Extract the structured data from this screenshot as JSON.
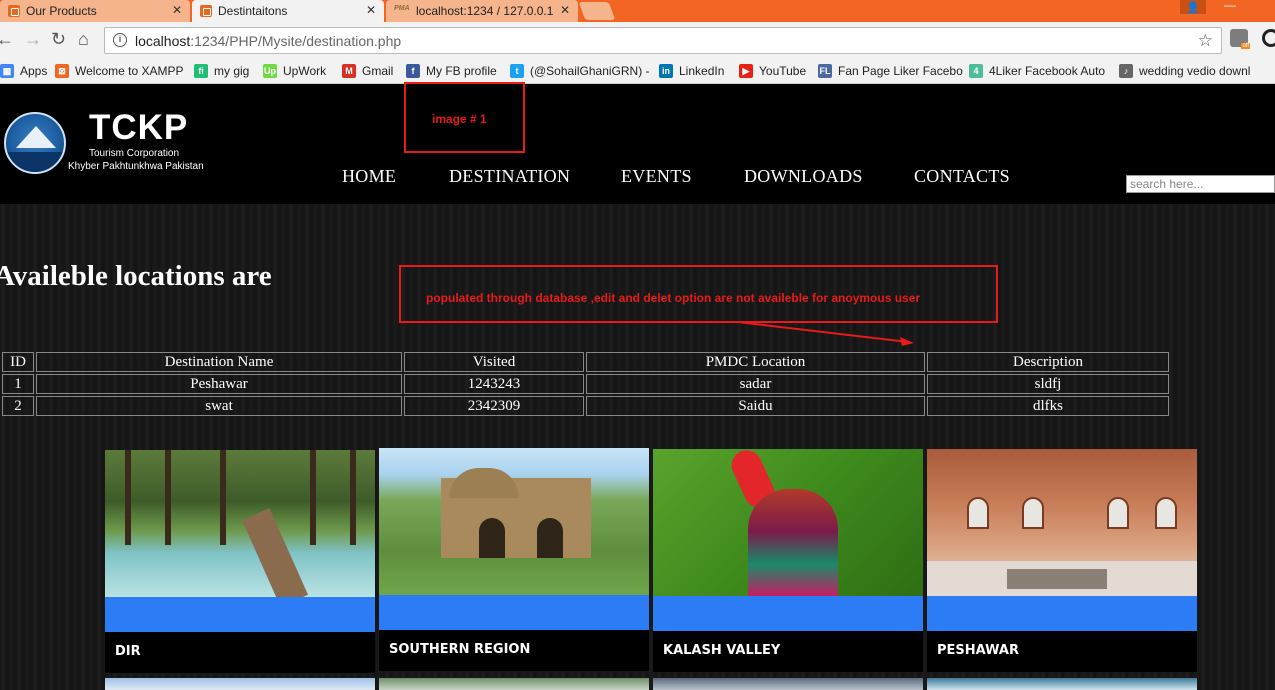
{
  "browser": {
    "tabs": [
      {
        "title": "Our Products",
        "active": false
      },
      {
        "title": "Destintaitons",
        "active": true
      },
      {
        "title": "localhost:1234 / 127.0.0.1",
        "active": false
      }
    ],
    "url_host": "localhost",
    "url_path": ":1234/PHP/Mysite/destination.php",
    "bookmarks": [
      {
        "label": "Apps",
        "icon": "apps-grid-icon",
        "color": "#4285f4"
      },
      {
        "label": "Welcome to XAMPP",
        "icon": "xampp-icon",
        "color": "#f26522"
      },
      {
        "label": "my gig",
        "icon": "fiverr-icon",
        "color": "#1dbf73"
      },
      {
        "label": "UpWork",
        "icon": "upwork-icon",
        "color": "#6fda44"
      },
      {
        "label": "Gmail",
        "icon": "gmail-icon",
        "color": "#d93025"
      },
      {
        "label": "My FB profile",
        "icon": "facebook-icon",
        "color": "#3b5998"
      },
      {
        "label": "(@SohailGhaniGRN) -",
        "icon": "twitter-icon",
        "color": "#1da1f2"
      },
      {
        "label": "LinkedIn",
        "icon": "linkedin-icon",
        "color": "#0077b5"
      },
      {
        "label": "YouTube",
        "icon": "youtube-icon",
        "color": "#e62117"
      },
      {
        "label": "Fan Page Liker Facebo",
        "icon": "fanpage-icon",
        "color": "#4b6aa3"
      },
      {
        "label": "4Liker Facebook Auto",
        "icon": "liker-icon",
        "color": "#4cbb9e"
      },
      {
        "label": "wedding vedio downl",
        "icon": "wedding-icon",
        "color": "#666666"
      }
    ]
  },
  "site": {
    "logo_title": "TCKP",
    "logo_sub1": "Tourism Corporation",
    "logo_sub2": "Khyber Pakhtunkhwa Pakistan",
    "nav": [
      "HOME",
      "DESTINATION",
      "EVENTS",
      "DOWNLOADS",
      "CONTACTS"
    ],
    "search_placeholder": "search here..."
  },
  "annotations": {
    "image_label": "image # 1",
    "db_note": "populated through database ,edit and delet option are not availeble for anoymous user",
    "color": "#e81a1a"
  },
  "main": {
    "heading": "Availeble locations are",
    "table": {
      "headers": [
        "ID",
        "Destination Name",
        "Visited",
        "PMDC Location",
        "Description"
      ],
      "rows": [
        [
          "1",
          "Peshawar",
          "1243243",
          "sadar",
          "sldfj"
        ],
        [
          "2",
          "swat",
          "2342309",
          "Saidu",
          "dlfks"
        ]
      ]
    },
    "cards": [
      {
        "label": "DIR"
      },
      {
        "label": "SOUTHERN REGION"
      },
      {
        "label": "KALASH VALLEY"
      },
      {
        "label": "PESHAWAR"
      }
    ],
    "card_band_color": "#2b7cf5"
  }
}
